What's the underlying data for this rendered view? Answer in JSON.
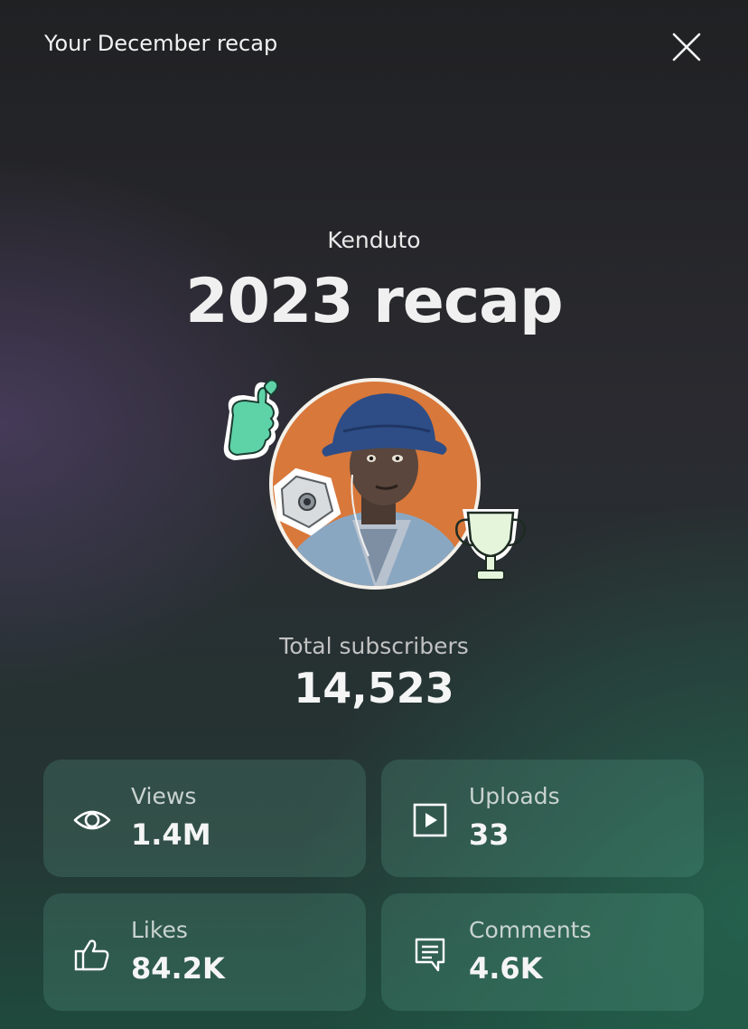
{
  "header": {
    "title": "Your December recap"
  },
  "channel": {
    "name": "Kenduto",
    "recap_title": "2023 recap"
  },
  "subscribers": {
    "label": "Total subscribers",
    "value": "14,523"
  },
  "stats": [
    {
      "label": "Views",
      "value": "1.4M",
      "icon": "eye-icon"
    },
    {
      "label": "Uploads",
      "value": "33",
      "icon": "play-square-icon"
    },
    {
      "label": "Likes",
      "value": "84.2K",
      "icon": "thumbs-up-icon"
    },
    {
      "label": "Comments",
      "value": "4.6K",
      "icon": "comment-icon"
    }
  ],
  "stickers": [
    "thumbs-up-heart-sticker",
    "ghost-shell-sticker",
    "trophy-sticker"
  ],
  "colors": {
    "avatar_background": "#d8783a",
    "card_background": "#3a6b5c",
    "sticker_green": "#5fd3a8",
    "trophy_fill": "#e4f5dc"
  }
}
